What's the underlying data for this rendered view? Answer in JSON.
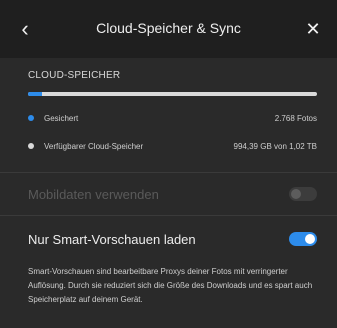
{
  "header": {
    "back_icon": "chevron-left-icon",
    "title": "Cloud-Speicher & Sync",
    "close_icon": "close-icon"
  },
  "storage": {
    "section_label": "CLOUD-SPEICHER",
    "used_fraction": 0.05,
    "used": {
      "label": "Gesichert",
      "value": "2.768 Fotos",
      "color": "#2d8ceb"
    },
    "available": {
      "label": "Verfügbarer Cloud-Speicher",
      "value": "994,39 GB von 1,02 TB",
      "color": "#d9d9d9"
    }
  },
  "settings": {
    "mobile_data": {
      "label": "Mobildaten verwenden",
      "enabled": false,
      "disabled": true
    },
    "smart_previews": {
      "label": "Nur Smart-Vorschauen laden",
      "enabled": true,
      "accent": "#2d8ceb"
    },
    "description": "Smart-Vorschauen sind bearbeitbare Proxys deiner Fotos mit verringerter Auflösung. Durch sie reduziert sich die Größe des Downloads und es spart auch Speicherplatz auf deinem Gerät."
  }
}
